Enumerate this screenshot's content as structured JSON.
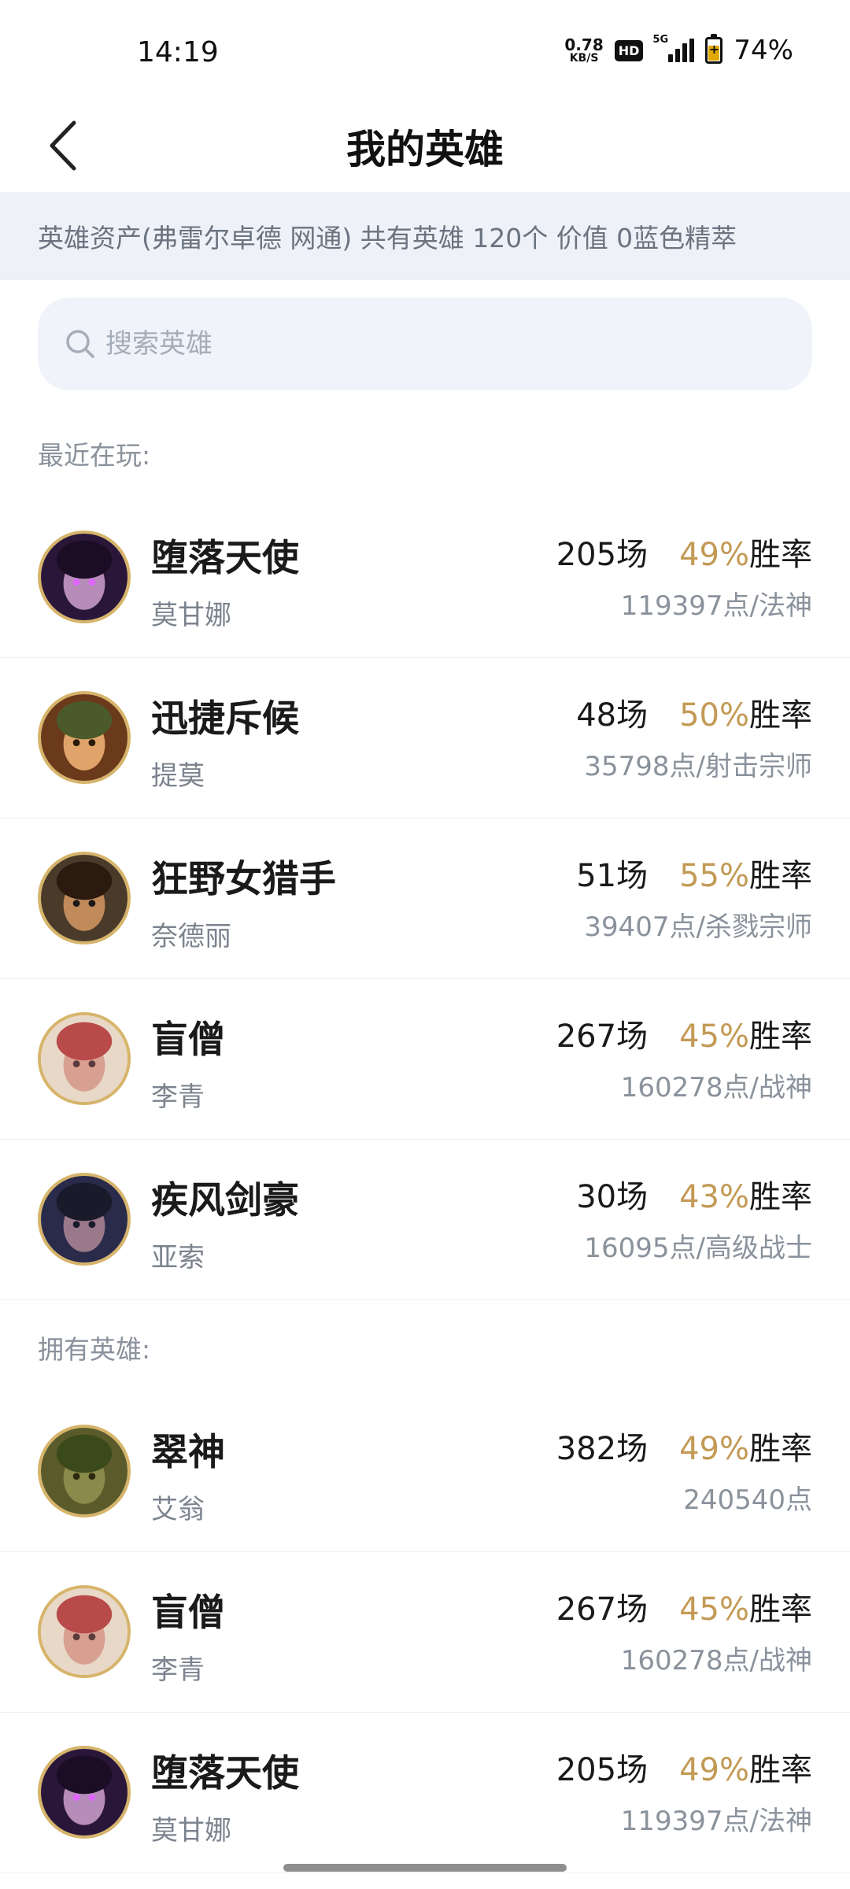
{
  "status_bar": {
    "time": "14:19",
    "net_speed_value": "0.78",
    "net_speed_unit": "KB/S",
    "hd_label": "HD",
    "network_label": "5G",
    "battery_level": 0.74,
    "battery_text": "74%",
    "icons": [
      "hd-icon",
      "signal-icon",
      "battery-icon"
    ]
  },
  "header": {
    "title": "我的英雄",
    "back_icon": "chevron-left-icon"
  },
  "asset_banner": {
    "text": "英雄资产(弗雷尔卓德 网通)  共有英雄 120个  价值 0蓝色精萃"
  },
  "search": {
    "placeholder": "搜索英雄",
    "value": "",
    "icon": "search-icon"
  },
  "recent": {
    "label": "最近在玩:",
    "heroes": [
      {
        "title": "堕落天使",
        "name": "莫甘娜",
        "games": "205场",
        "rate": "49%",
        "rate_suffix": "胜率",
        "points": "119397点/法神"
      },
      {
        "title": "迅捷斥候",
        "name": "提莫",
        "games": "48场",
        "rate": "50%",
        "rate_suffix": "胜率",
        "points": "35798点/射击宗师"
      },
      {
        "title": "狂野女猎手",
        "name": "奈德丽",
        "games": "51场",
        "rate": "55%",
        "rate_suffix": "胜率",
        "points": "39407点/杀戮宗师"
      },
      {
        "title": "盲僧",
        "name": "李青",
        "games": "267场",
        "rate": "45%",
        "rate_suffix": "胜率",
        "points": "160278点/战神"
      },
      {
        "title": "疾风剑豪",
        "name": "亚索",
        "games": "30场",
        "rate": "43%",
        "rate_suffix": "胜率",
        "points": "16095点/高级战士"
      }
    ]
  },
  "owned": {
    "label": "拥有英雄:",
    "heroes": [
      {
        "title": "翠神",
        "name": "艾翁",
        "games": "382场",
        "rate": "49%",
        "rate_suffix": "胜率",
        "points": "240540点"
      },
      {
        "title": "盲僧",
        "name": "李青",
        "games": "267场",
        "rate": "45%",
        "rate_suffix": "胜率",
        "points": "160278点/战神"
      },
      {
        "title": "堕落天使",
        "name": "莫甘娜",
        "games": "205场",
        "rate": "49%",
        "rate_suffix": "胜率",
        "points": "119397点/法神"
      }
    ]
  },
  "colors": {
    "accent_rate": "#c39a55",
    "avatar_border": "#d6b46a",
    "banner_bg": "#eef2f8",
    "search_bg": "#f0f3f9"
  }
}
